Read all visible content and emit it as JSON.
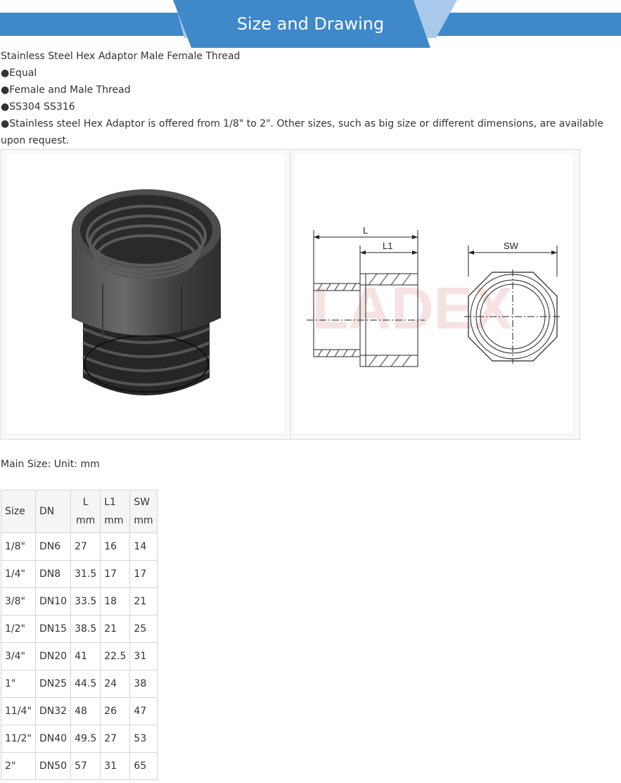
{
  "banner": {
    "title": "Size and Drawing",
    "color_main": "#3f88c9",
    "color_light": "#a8c9ea"
  },
  "intro": {
    "title": "Stainless Steel Hex Adaptor Male Female Thread",
    "bullets": [
      "●Equal",
      "●Female and Male Thread",
      "●SS304 SS316",
      "●Stainless steel Hex Adaptor is offered from 1/8\" to 2\". Other sizes, such as big size or different dimensions, are available upon request."
    ]
  },
  "drawing": {
    "label_l": "L",
    "label_l1": "L1",
    "label_sw": "SW",
    "watermark": "LADEX"
  },
  "main_size": "Main Size:   Unit:  mm",
  "table": {
    "headers": [
      {
        "name": "Size",
        "unit": ""
      },
      {
        "name": "DN",
        "unit": ""
      },
      {
        "name": "L",
        "unit": "mm"
      },
      {
        "name": "L1",
        "unit": "mm"
      },
      {
        "name": "SW",
        "unit": "mm"
      }
    ],
    "rows": [
      [
        "1/8\"",
        "DN6",
        "27",
        "16",
        "14"
      ],
      [
        "1/4\"",
        "DN8",
        "31.5",
        "17",
        "17"
      ],
      [
        "3/8\"",
        "DN10",
        "33.5",
        "18",
        "21"
      ],
      [
        "1/2\"",
        "DN15",
        "38.5",
        "21",
        "25"
      ],
      [
        "3/4\"",
        "DN20",
        "41",
        "22.5",
        "31"
      ],
      [
        "1\"",
        "DN25",
        "44.5",
        "24",
        "38"
      ],
      [
        "11/4\"",
        "DN32",
        "48",
        "26",
        "47"
      ],
      [
        "11/2\"",
        "DN40",
        "49.5",
        "27",
        "53"
      ],
      [
        "2\"",
        "DN50",
        "57",
        "31",
        "65"
      ]
    ]
  }
}
